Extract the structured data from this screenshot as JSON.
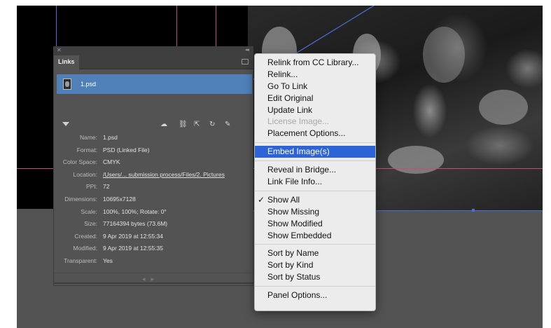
{
  "panel": {
    "tab_label": "Links",
    "link_name": "1.psd",
    "info": [
      {
        "key": "Name:",
        "value": "1.psd",
        "link": false
      },
      {
        "key": "Format:",
        "value": "PSD (Linked File)",
        "link": false
      },
      {
        "key": "Color Space:",
        "value": "CMYK",
        "link": false
      },
      {
        "key": "Location:",
        "value": "/Users/... submission process/Files/2. Pictures",
        "link": true
      },
      {
        "key": "PPI:",
        "value": "72",
        "link": false
      },
      {
        "key": "Dimensions:",
        "value": "10695x7128",
        "link": false
      },
      {
        "key": "Scale:",
        "value": "100%, 100%; Rotate: 0°",
        "link": false
      },
      {
        "key": "Size:",
        "value": "77164394 bytes (73.6M)",
        "link": false
      },
      {
        "key": "Created:",
        "value": "9 Apr 2019 at 12:55:34",
        "link": false
      },
      {
        "key": "Modified:",
        "value": "9 Apr 2019 at 12:55:35",
        "link": false
      },
      {
        "key": "Transparent:",
        "value": "Yes",
        "link": false
      }
    ],
    "toolbar_icons": [
      "cc-library-icon",
      "relink-icon",
      "go-to-link-icon",
      "update-link-icon",
      "edit-original-icon"
    ]
  },
  "menu": {
    "groups": [
      [
        {
          "label": "Relink from CC Library...",
          "disabled": false
        },
        {
          "label": "Relink...",
          "disabled": false
        },
        {
          "label": "Go To Link",
          "disabled": false
        },
        {
          "label": "Edit Original",
          "disabled": false
        },
        {
          "label": "Update Link",
          "disabled": false
        },
        {
          "label": "License Image...",
          "disabled": true
        },
        {
          "label": "Placement Options...",
          "disabled": false
        }
      ],
      [
        {
          "label": "Embed Image(s)",
          "disabled": false,
          "selected": true
        }
      ],
      [
        {
          "label": "Reveal in Bridge...",
          "disabled": false
        },
        {
          "label": "Link File Info...",
          "disabled": false
        }
      ],
      [
        {
          "label": "Show All",
          "disabled": false,
          "checked": true
        },
        {
          "label": "Show Missing",
          "disabled": false
        },
        {
          "label": "Show Modified",
          "disabled": false
        },
        {
          "label": "Show Embedded",
          "disabled": false
        }
      ],
      [
        {
          "label": "Sort by Name",
          "disabled": false
        },
        {
          "label": "Sort by Kind",
          "disabled": false
        },
        {
          "label": "Sort by Status",
          "disabled": false
        }
      ],
      [
        {
          "label": "Panel Options...",
          "disabled": false
        }
      ]
    ]
  },
  "colors": {
    "selection": "#2c63d6",
    "link_row": "#4f81b8",
    "guide": "#c0507a",
    "frame": "#4a6fd8"
  }
}
